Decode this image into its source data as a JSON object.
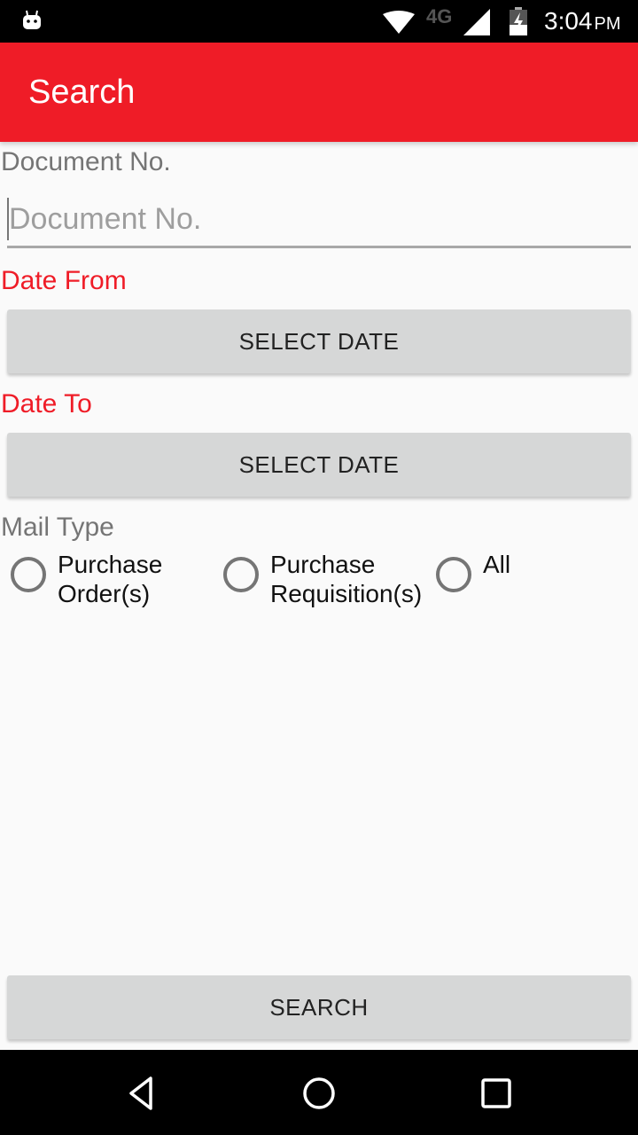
{
  "status_bar": {
    "network_type": "4G",
    "time": "3:04",
    "ampm": "PM"
  },
  "app_bar": {
    "title": "Search"
  },
  "form": {
    "document_no": {
      "label": "Document No.",
      "value": "",
      "placeholder": "Document No."
    },
    "date_from": {
      "label": "Date From",
      "button_label": "SELECT DATE"
    },
    "date_to": {
      "label": "Date To",
      "button_label": "SELECT DATE"
    },
    "mail_type": {
      "label": "Mail Type",
      "options": [
        {
          "line1": "Purchase",
          "line2": "Order(s)",
          "selected": false
        },
        {
          "line1": "Purchase",
          "line2": "Requisition(s)",
          "selected": false
        },
        {
          "line1": "All",
          "line2": "",
          "selected": false
        }
      ]
    },
    "search_button_label": "SEARCH"
  },
  "colors": {
    "accent": "#ef1c27",
    "button_bg": "#d6d7d7",
    "background": "#fafafa"
  }
}
